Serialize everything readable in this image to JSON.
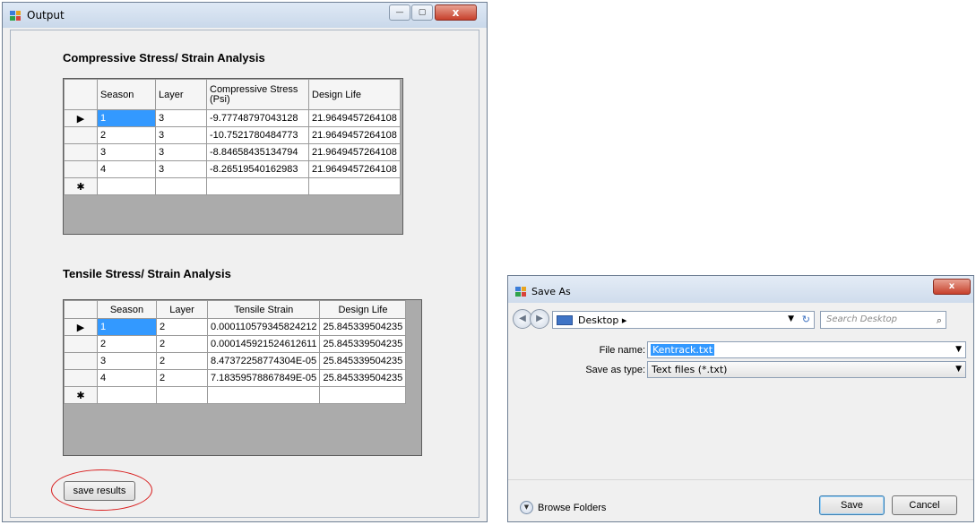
{
  "output_window": {
    "title": "Output",
    "minimize_glyph": "—",
    "maximize_glyph": "▢",
    "close_glyph": "x",
    "compressive": {
      "title": "Compressive Stress/ Strain Analysis",
      "headers": [
        "Season",
        "Layer",
        "Compressive Stress (Psi)",
        "Design Life"
      ],
      "rows": [
        [
          "1",
          "3",
          "-9.77748797043128",
          "21.9649457264108"
        ],
        [
          "2",
          "3",
          "-10.7521780484773",
          "21.9649457264108"
        ],
        [
          "3",
          "3",
          "-8.84658435134794",
          "21.9649457264108"
        ],
        [
          "4",
          "3",
          "-8.26519540162983",
          "21.9649457264108"
        ]
      ]
    },
    "tensile": {
      "title": "Tensile Stress/ Strain Analysis",
      "headers": [
        "Season",
        "Layer",
        "Tensile Strain",
        "Design Life"
      ],
      "rows": [
        [
          "1",
          "2",
          "0.000110579345824212",
          "25.845339504235"
        ],
        [
          "2",
          "2",
          "0.000145921524612611",
          "25.845339504235"
        ],
        [
          "3",
          "2",
          "8.47372258774304E-05",
          "25.845339504235"
        ],
        [
          "4",
          "2",
          "7.18359578867849E-05",
          "25.845339504235"
        ]
      ]
    },
    "selected_row_marker": "▶",
    "new_row_marker": "✱",
    "save_results_label": "save results",
    "annotation_color": "#d81c1c"
  },
  "save_as": {
    "title": "Save As",
    "close_glyph": "x",
    "address": "Desktop ▸",
    "search_placeholder": "Search Desktop",
    "file_name_label": "File name:",
    "file_name_value": "Kentrack.txt",
    "save_as_type_label": "Save as type:",
    "save_as_type_value": "Text files (*.txt)",
    "browse_folders_label": "Browse Folders",
    "save_label": "Save",
    "cancel_label": "Cancel"
  },
  "colors": {
    "selection": "#3399ff",
    "grid_background": "#ababab",
    "window_face": "#f0f0f0"
  }
}
